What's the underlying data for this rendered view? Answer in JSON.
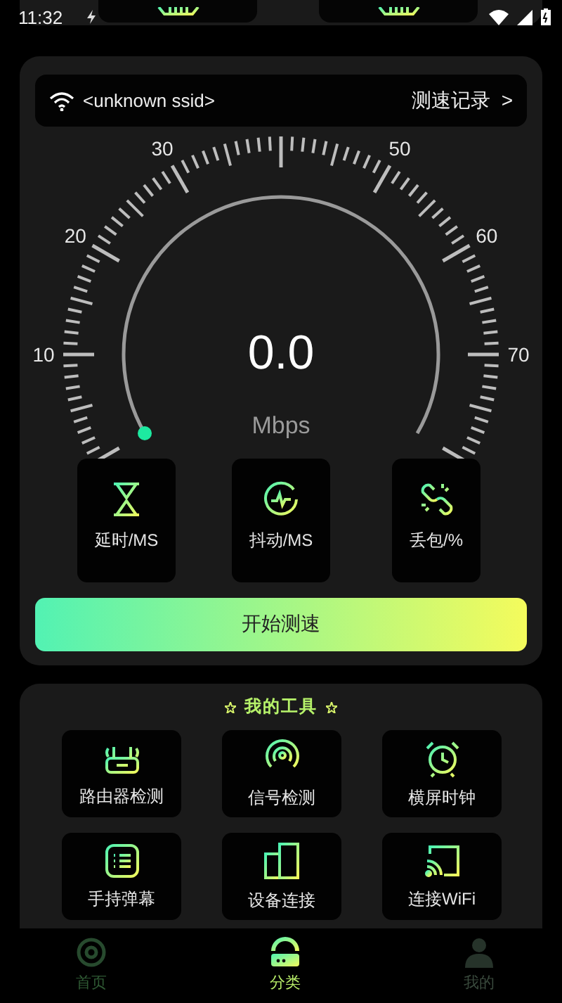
{
  "status_bar": {
    "time": "11:32"
  },
  "network": {
    "ssid": "<unknown ssid>",
    "history_link": "测速记录",
    "history_arrow": ">"
  },
  "gauge": {
    "scale_labels": [
      "10",
      "20",
      "30",
      "50",
      "60",
      "70"
    ],
    "reading": "0.0",
    "unit": "Mbps"
  },
  "stats": [
    {
      "kind": "latency",
      "label": "延时/MS"
    },
    {
      "kind": "jitter",
      "label": "抖动/MS"
    },
    {
      "kind": "loss",
      "label": "丢包/%"
    }
  ],
  "start_button": "开始测速",
  "tools": {
    "title": "我的工具",
    "items": [
      {
        "kind": "router",
        "label": "路由器检测"
      },
      {
        "kind": "signal",
        "label": "信号检测"
      },
      {
        "kind": "clock",
        "label": "横屏时钟"
      },
      {
        "kind": "list",
        "label": "手持弹幕"
      },
      {
        "kind": "devices",
        "label": "设备连接"
      },
      {
        "kind": "cast",
        "label": "连接WiFi"
      }
    ]
  },
  "bottom_nav": [
    {
      "kind": "home",
      "label": "首页",
      "selected": false
    },
    {
      "kind": "category",
      "label": "分类",
      "selected": true
    },
    {
      "kind": "profile",
      "label": "我的",
      "selected": false
    }
  ]
}
